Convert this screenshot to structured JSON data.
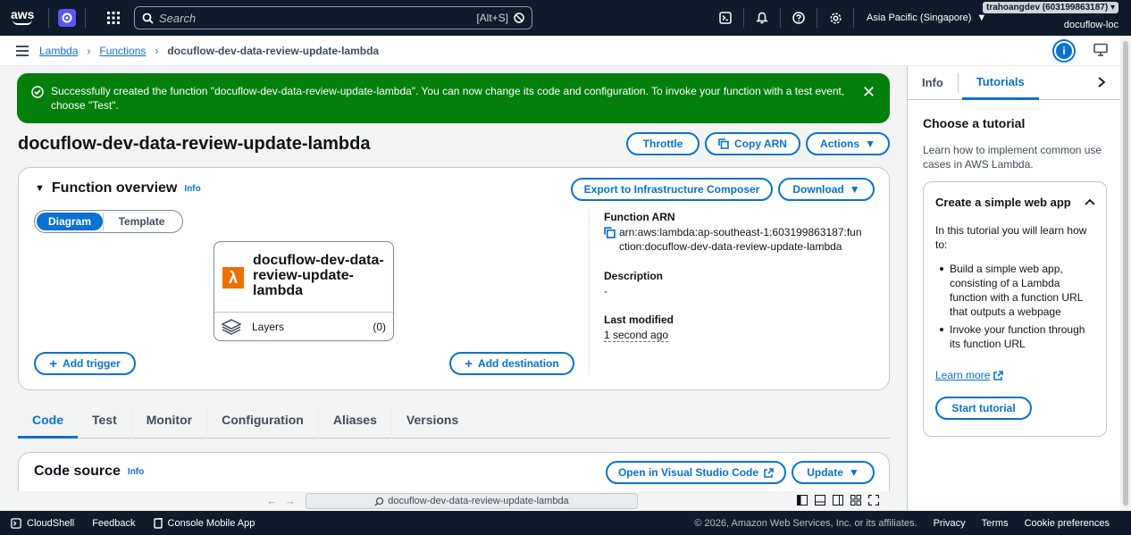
{
  "topnav": {
    "logo": "aws",
    "search_placeholder": "Search",
    "search_shortcut": "[Alt+S]",
    "region": "Asia Pacific (Singapore)",
    "account_id": "trahoangdev (603199863187)",
    "account_alias": "docuflow-loc"
  },
  "breadcrumb": {
    "items": [
      "Lambda",
      "Functions"
    ],
    "current": "docuflow-dev-data-review-update-lambda"
  },
  "flash": {
    "message": "Successfully created the function \"docuflow-dev-data-review-update-lambda\". You can now change its code and configuration. To invoke your function with a test event, choose \"Test\"."
  },
  "page": {
    "title": "docuflow-dev-data-review-update-lambda",
    "throttle": "Throttle",
    "copy_arn": "Copy ARN",
    "actions": "Actions"
  },
  "overview": {
    "title": "Function overview",
    "info": "Info",
    "export": "Export to Infrastructure Composer",
    "download": "Download",
    "seg_diagram": "Diagram",
    "seg_template": "Template",
    "function_name": "docuflow-dev-data-review-update-lambda",
    "layers_label": "Layers",
    "layers_count": "(0)",
    "add_trigger": "Add trigger",
    "add_destination": "Add destination",
    "arn_label": "Function ARN",
    "arn_value": "arn:aws:lambda:ap-southeast-1:603199863187:function:docuflow-dev-data-review-update-lambda",
    "desc_label": "Description",
    "desc_value": "-",
    "modified_label": "Last modified",
    "modified_value": "1 second ago"
  },
  "tabs": [
    "Code",
    "Test",
    "Monitor",
    "Configuration",
    "Aliases",
    "Versions"
  ],
  "code_source": {
    "title": "Code source",
    "info": "Info",
    "open_vscode": "Open in Visual Studio Code",
    "update": "Update",
    "editor_search": "docuflow-dev-data-review-update-lambda"
  },
  "right_panel": {
    "tab_info": "Info",
    "tab_tutorials": "Tutorials",
    "heading": "Choose a tutorial",
    "description": "Learn how to implement common use cases in AWS Lambda.",
    "card_title": "Create a simple web app",
    "card_intro": "In this tutorial you will learn how to:",
    "bullets": [
      "Build a simple web app, consisting of a Lambda function with a function URL that outputs a webpage",
      "Invoke your function through its function URL"
    ],
    "learn_more": "Learn more",
    "start": "Start tutorial"
  },
  "footer": {
    "cloudshell": "CloudShell",
    "feedback": "Feedback",
    "mobile": "Console Mobile App",
    "copyright": "© 2026, Amazon Web Services, Inc. or its affiliates.",
    "privacy": "Privacy",
    "terms": "Terms",
    "cookies": "Cookie preferences"
  },
  "colors": {
    "nav_bg": "#0f1b2a",
    "accent": "#0972d3",
    "success": "#037f0c",
    "lambda": "#ed7100"
  }
}
